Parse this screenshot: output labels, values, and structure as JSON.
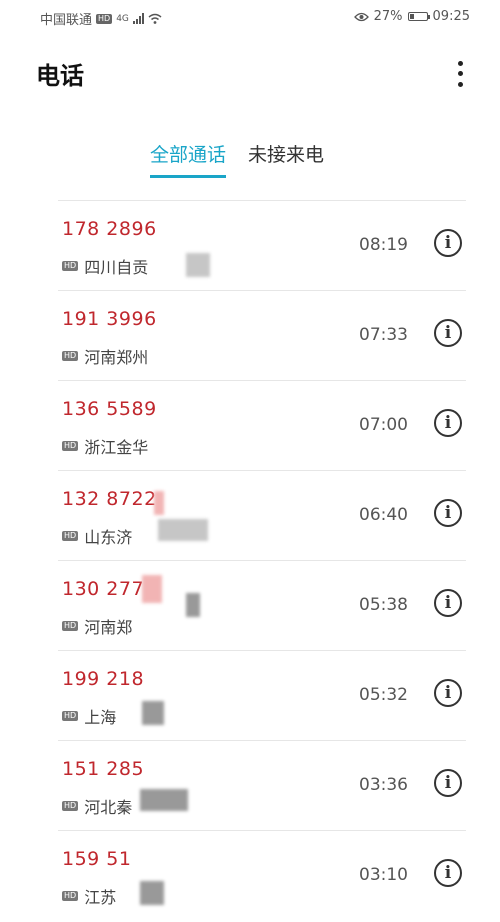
{
  "status_bar": {
    "carrier": "中国联通",
    "hd_badge": "HD",
    "network": "4G",
    "battery_percent": "27%",
    "battery_level": 0.27,
    "time": "09:25",
    "icons": [
      "signal-icon",
      "wifi-icon",
      "eye-icon",
      "battery-icon"
    ]
  },
  "header": {
    "title": "电话",
    "menu_icon": "more-vertical-icon"
  },
  "tabs": [
    {
      "label": "全部通话",
      "active": true
    },
    {
      "label": "未接来电",
      "active": false
    }
  ],
  "accent_color": "#1aa5c8",
  "missed_color": "#c0272d",
  "calls": [
    {
      "number": "178 2896",
      "location": "四川自贡",
      "time": "08:19"
    },
    {
      "number": "191 3996",
      "location": "河南郑州",
      "time": "07:33"
    },
    {
      "number": "136 5589",
      "location": "浙江金华",
      "time": "07:00"
    },
    {
      "number": "132 8722",
      "location": "山东济",
      "time": "06:40"
    },
    {
      "number": "130 277",
      "location": "河南郑",
      "time": "05:38"
    },
    {
      "number": "199 218",
      "location": "上海",
      "time": "05:32"
    },
    {
      "number": "151 285",
      "location": "河北秦",
      "time": "03:36"
    },
    {
      "number": "159 51",
      "location": "江苏",
      "time": "03:10"
    }
  ],
  "hd_label": "HD",
  "info_glyph": "i"
}
